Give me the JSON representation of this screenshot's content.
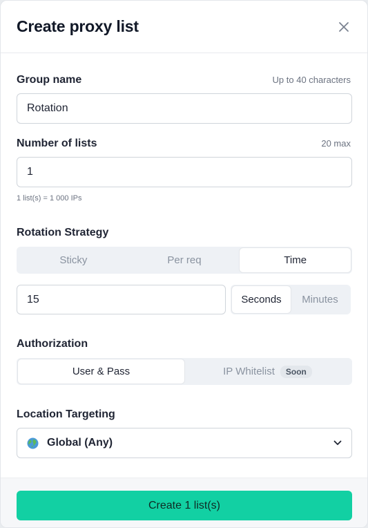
{
  "modal": {
    "title": "Create proxy list",
    "close_icon": "close-icon"
  },
  "group_name": {
    "label": "Group name",
    "hint": "Up to 40 characters",
    "value": "Rotation"
  },
  "number_of_lists": {
    "label": "Number of lists",
    "hint": "20 max",
    "value": "1",
    "sub": "1 list(s) = 1 000 IPs"
  },
  "rotation": {
    "label": "Rotation Strategy",
    "options": [
      "Sticky",
      "Per req",
      "Time"
    ],
    "selected": "Time",
    "time_value": "15",
    "units": [
      "Seconds",
      "Minutes"
    ],
    "selected_unit": "Seconds"
  },
  "authorization": {
    "label": "Authorization",
    "options": [
      "User & Pass",
      "IP Whitelist"
    ],
    "selected": "User & Pass",
    "badge": "Soon"
  },
  "location": {
    "label": "Location Targeting",
    "value": "Global (Any)",
    "icon": "globe-icon"
  },
  "footer": {
    "cta": "Create 1 list(s)"
  },
  "colors": {
    "accent": "#12d0a3",
    "segment_bg": "#eef1f5"
  }
}
